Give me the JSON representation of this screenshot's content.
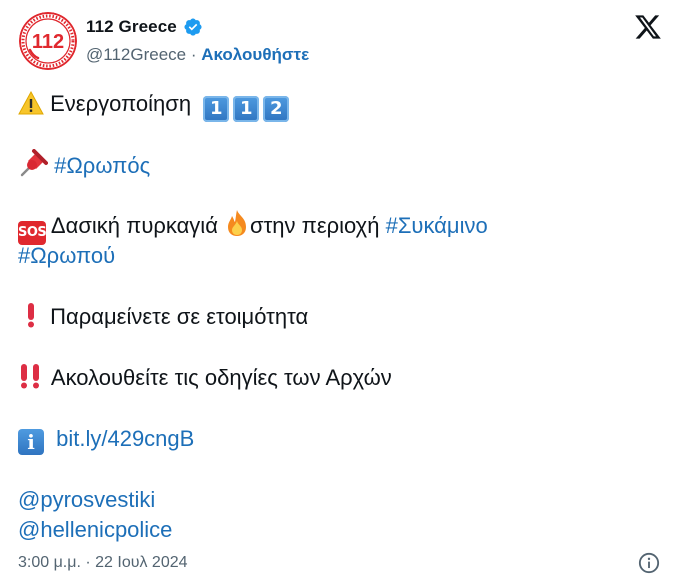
{
  "author": {
    "display_name": "112 Greece",
    "handle": "@112Greece",
    "separator": " · ",
    "follow_label": "Ακολουθήστε",
    "avatar_text": "112"
  },
  "icons": {
    "verified": "verified-badge-icon",
    "platform": "x-logo-icon",
    "info": "info-icon"
  },
  "tweet": {
    "line1_text": "Ενεργοποίηση",
    "line1_keycaps": [
      "1",
      "1",
      "2"
    ],
    "line2_hashtag": "#Ωρωπός",
    "line3_sos": "SOS",
    "line3_text_a": "Δασική πυρκαγιά ",
    "line3_text_b": "στην περιοχή ",
    "line3_hashtag": "#Συκάμινο",
    "line4_hashtag": "#Ωρωπού",
    "line5_text": "Παραμείνετε σε ετοιμότητα",
    "line6_text": "Ακολουθείτε τις οδηγίες των Αρχών",
    "line7_info": "i",
    "line7_link": "bit.ly/429cngB",
    "mention_1": "@pyrosvestiki",
    "mention_2": "@hellenicpolice"
  },
  "meta": {
    "timestamp": "3:00 μ.μ. · 22 Ιουλ 2024"
  },
  "colors": {
    "link": "#1d6fb8",
    "secondary_text": "#536471",
    "verified": "#1d9bf0",
    "brand_red": "#e0282e"
  }
}
